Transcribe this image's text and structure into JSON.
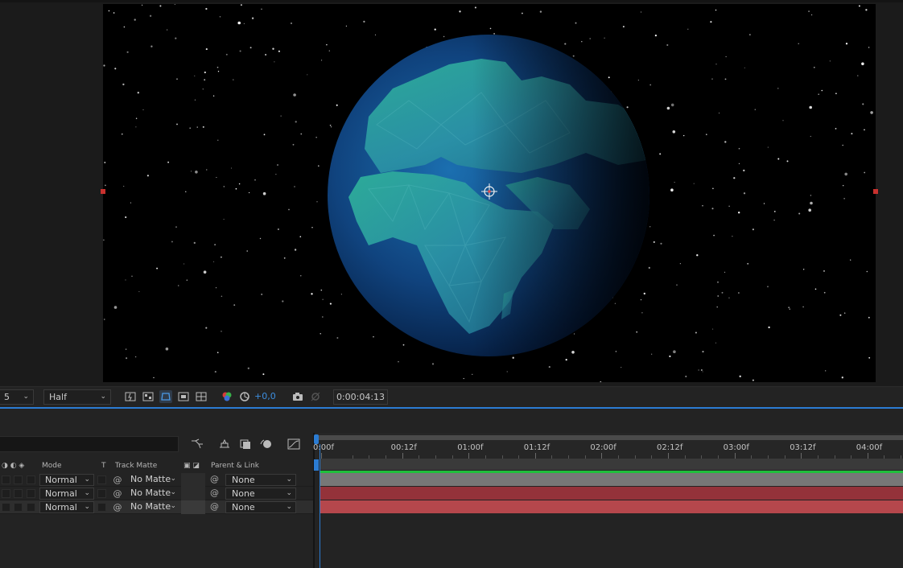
{
  "viewer": {
    "left_dropdown_value": "5",
    "resolution": "Half",
    "exposure_value": "+0,0",
    "timecode": "0:00:04:13"
  },
  "timeline": {
    "columns": {
      "mode": "Mode",
      "t": "T",
      "track_matte": "Track Matte",
      "parent_link": "Parent & Link"
    },
    "ruler_ticks": [
      "0:00f",
      "00:12f",
      "01:00f",
      "01:12f",
      "02:00f",
      "02:12f",
      "03:00f",
      "03:12f",
      "04:00f"
    ],
    "layers": [
      {
        "mode": "Normal",
        "track_matte": "No Matte",
        "parent": "None"
      },
      {
        "mode": "Normal",
        "track_matte": "No Matte",
        "parent": "None"
      },
      {
        "mode": "Normal",
        "track_matte": "No Matte",
        "parent": "None"
      }
    ]
  },
  "colors": {
    "accent": "#2b7cd3",
    "layer1_bar": "#777777",
    "layer2_bar": "#94323a",
    "layer3_bar": "#b5474c",
    "work_area_green": "#1fbf3b"
  }
}
